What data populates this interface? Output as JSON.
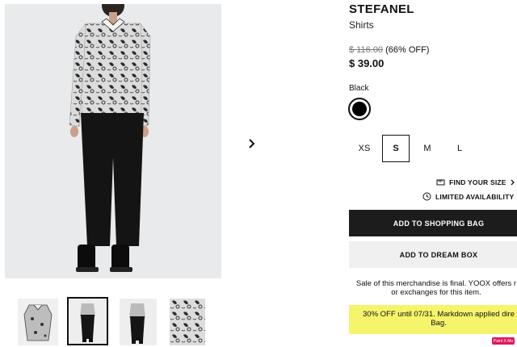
{
  "product": {
    "brand": "STEFANEL",
    "category": "Shirts",
    "original_price": "$ 116.00",
    "discount": "(66% OFF)",
    "price": "$ 39.00"
  },
  "color": {
    "label": "Black",
    "swatch_hex": "#000000"
  },
  "sizes": [
    {
      "label": "XS",
      "selected": false
    },
    {
      "label": "S",
      "selected": true
    },
    {
      "label": "M",
      "selected": false
    },
    {
      "label": "L",
      "selected": false
    }
  ],
  "links": {
    "find_size": "FIND YOUR SIZE",
    "limited": "LIMITED AVAILABILITY"
  },
  "buttons": {
    "add_to_bag": "ADD TO SHOPPING BAG",
    "add_to_dream": "ADD TO DREAM BOX"
  },
  "notices": {
    "final_sale_line1": "Sale of this merchandise is final. YOOX offers r",
    "final_sale_line2": "or exchanges for this item.",
    "promo_line1": "30% OFF until 07/31. Markdown applied dire",
    "promo_line2": "Bag."
  },
  "badge": {
    "label": "Paint X Me"
  },
  "gallery": {
    "thumbnails": 4,
    "selected_thumbnail": 2
  },
  "icons": [
    "chevron-right-icon",
    "ruler-icon",
    "clock-icon"
  ]
}
